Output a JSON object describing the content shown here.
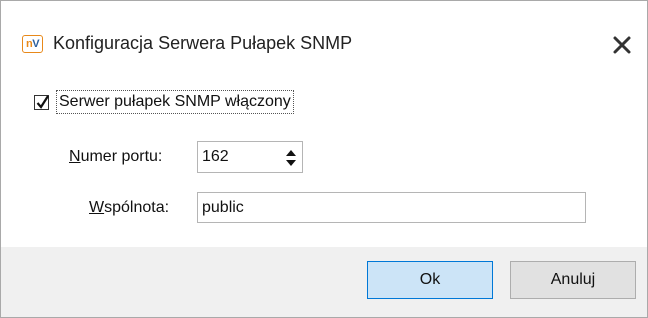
{
  "window": {
    "title": "Konfiguracja Serwera Pułapek SNMP",
    "icon_text_n": "n",
    "icon_text_v": "V",
    "icon": "nv-app-icon",
    "close_icon": "close-icon"
  },
  "snmp_enabled": {
    "label": "Serwer pułapek SNMP włączony",
    "checked": true
  },
  "port": {
    "label_mnemonic": "N",
    "label_rest": "umer portu:",
    "value": "162"
  },
  "community": {
    "label_mnemonic": "W",
    "label_rest": "spólnota:",
    "value": "public"
  },
  "buttons": {
    "ok": "Ok",
    "cancel": "Anuluj"
  },
  "colors": {
    "accent": "#0078d7",
    "icon_orange": "#e8891a",
    "icon_blue": "#2b5f9e"
  }
}
